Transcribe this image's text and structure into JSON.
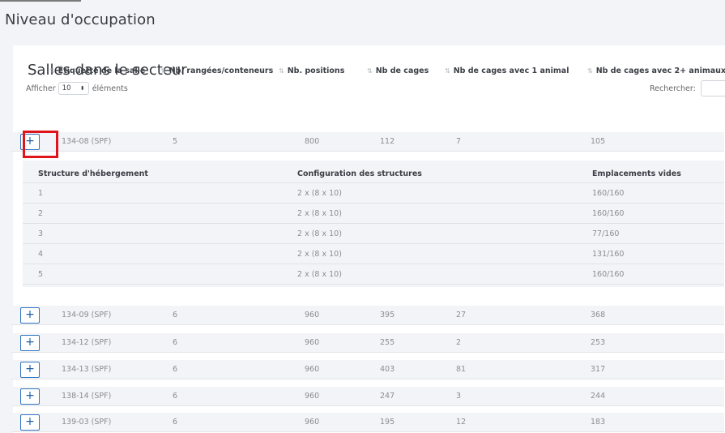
{
  "page": {
    "title": "Niveau d'occupation"
  },
  "section": {
    "title": "Salles dans le secteur",
    "length_prefix": "Afficher",
    "length_value": "10",
    "length_suffix": "éléments",
    "search_label": "Rechercher:"
  },
  "table": {
    "headers": [
      "Étiquette de la salle",
      "Nb. rangées/conteneurs",
      "Nb. positions",
      "Nb de cages",
      "Nb de cages avec 1 animal",
      "Nb de cages avec 2+ animaux"
    ],
    "expand_label": "+",
    "rows": [
      {
        "salle": "134-08 (SPF)",
        "rangees": "5",
        "positions": "800",
        "cages": "112",
        "cages1": "7",
        "cages2": "105"
      },
      {
        "salle": "134-09 (SPF)",
        "rangees": "6",
        "positions": "960",
        "cages": "395",
        "cages1": "27",
        "cages2": "368"
      },
      {
        "salle": "134-12 (SPF)",
        "rangees": "6",
        "positions": "960",
        "cages": "255",
        "cages1": "2",
        "cages2": "253"
      },
      {
        "salle": "134-13 (SPF)",
        "rangees": "6",
        "positions": "960",
        "cages": "403",
        "cages1": "81",
        "cages2": "317"
      },
      {
        "salle": "138-14 (SPF)",
        "rangees": "6",
        "positions": "960",
        "cages": "247",
        "cages1": "3",
        "cages2": "244"
      },
      {
        "salle": "139-03 (SPF)",
        "rangees": "6",
        "positions": "960",
        "cages": "195",
        "cages1": "12",
        "cages2": "183"
      }
    ],
    "child": {
      "headers": [
        "Structure d'hébergement",
        "Configuration des structures",
        "Emplacements vides"
      ],
      "rows": [
        {
          "structure": "1",
          "config": "2 x (8 x 10)",
          "vides": "160/160"
        },
        {
          "structure": "2",
          "config": "2 x (8 x 10)",
          "vides": "160/160"
        },
        {
          "structure": "3",
          "config": "2 x (8 x 10)",
          "vides": "77/160"
        },
        {
          "structure": "4",
          "config": "2 x (8 x 10)",
          "vides": "131/160"
        },
        {
          "structure": "5",
          "config": "2 x (8 x 10)",
          "vides": "160/160"
        }
      ]
    }
  },
  "colors": {
    "accent": "#2f74c0",
    "highlight": "#e0151b",
    "row_bg": "#f3f4f7"
  }
}
